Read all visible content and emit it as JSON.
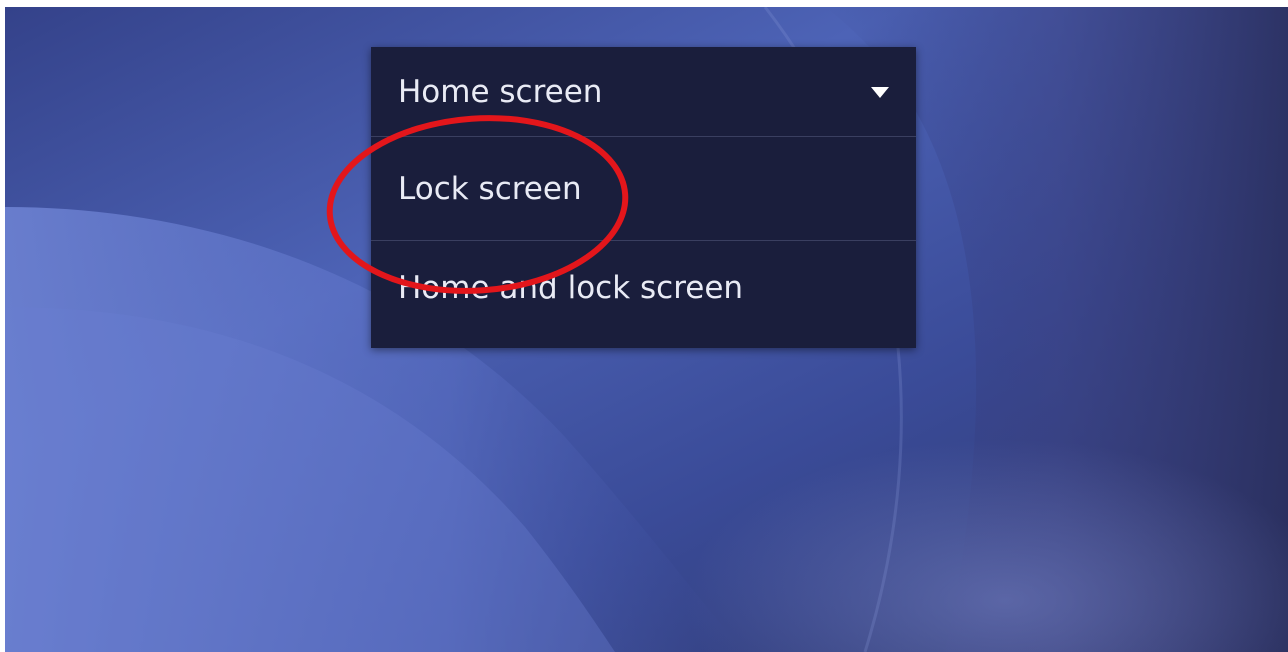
{
  "colors": {
    "wallpaper_light": "#6378c8",
    "wallpaper_dark": "#2c3468",
    "dropdown_bg": "#1a1e3c",
    "divider": "#3a3f60",
    "text": "#e9ebf5",
    "highlight": "#e3161b"
  },
  "dropdown": {
    "selected": "Home screen",
    "caret_icon": "caret-down-icon",
    "options": [
      {
        "label": "Home screen"
      },
      {
        "label": "Lock screen"
      },
      {
        "label": "Home and lock screen"
      }
    ]
  },
  "annotation": {
    "shape": "ellipse",
    "target": "Lock screen"
  }
}
